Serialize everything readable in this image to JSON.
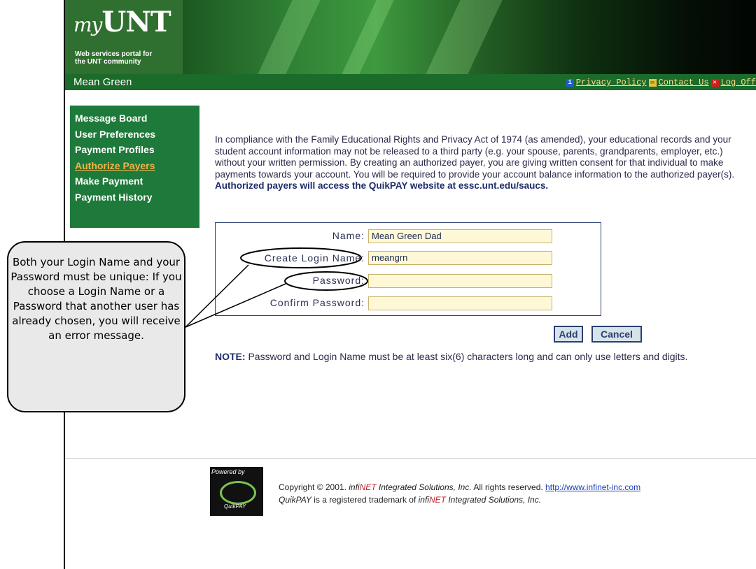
{
  "header": {
    "logo": "myUNT",
    "tagline_line1": "Web services portal for",
    "tagline_line2": "the UNT community",
    "user_name": "Mean Green",
    "links": [
      {
        "label": "Privacy Policy",
        "icon": "info-icon"
      },
      {
        "label": "Contact Us",
        "icon": "mail-icon"
      },
      {
        "label": "Log Off",
        "icon": "close-icon"
      }
    ]
  },
  "nav": {
    "items": [
      {
        "label": "Message Board"
      },
      {
        "label": "User Preferences"
      },
      {
        "label": "Payment Profiles"
      },
      {
        "label": "Authorize Payers",
        "active": true
      },
      {
        "label": "Make Payment"
      },
      {
        "label": "Payment History"
      }
    ]
  },
  "main": {
    "intro": "In compliance with the Family Educational Rights and Privacy Act of 1974 (as amended), your educational records and your student account information may not be released to a third party (e.g. your spouse, parents, grandparents, employer, etc.) without your written permission. By creating an authorized payer, you are giving written consent for that individual to make payments towards your account. You will be required to provide your account balance information to the authorized payer(s).",
    "intro_bold": "Authorized payers will access the QuikPAY website at essc.unt.edu/saucs.",
    "form": {
      "name_label": "Name:",
      "name_value": "Mean Green Dad",
      "login_label": "Create Login Name:",
      "login_value": "meangrn",
      "password_label": "Password:",
      "password_value": "",
      "confirm_label": "Confirm Password:",
      "confirm_value": ""
    },
    "add_label": "Add",
    "cancel_label": "Cancel",
    "note_bold": "NOTE:",
    "note_text": " Password and Login Name must be at least six(6) characters long and can only use letters and digits."
  },
  "footer": {
    "powered_by": "Powered by",
    "brand": "QuikPAY",
    "copyright_pre": "Copyright © 2001. ",
    "company_a": "infi",
    "company_b": "NET",
    "company_c": " Integrated Solutions, Inc.",
    "rights": " All rights reserved. ",
    "link": "http://www.infinet-inc.com",
    "tm_a": "QuikPAY",
    "tm_b": " is a registered trademark of ",
    "tm_c": "infi",
    "tm_d": "NET",
    "tm_e": " Integrated Solutions, Inc."
  },
  "callout": {
    "text": "Both your Login Name and your Password must be unique: If you choose a Login Name or a Password that another user has already chosen, you will receive an error message."
  }
}
